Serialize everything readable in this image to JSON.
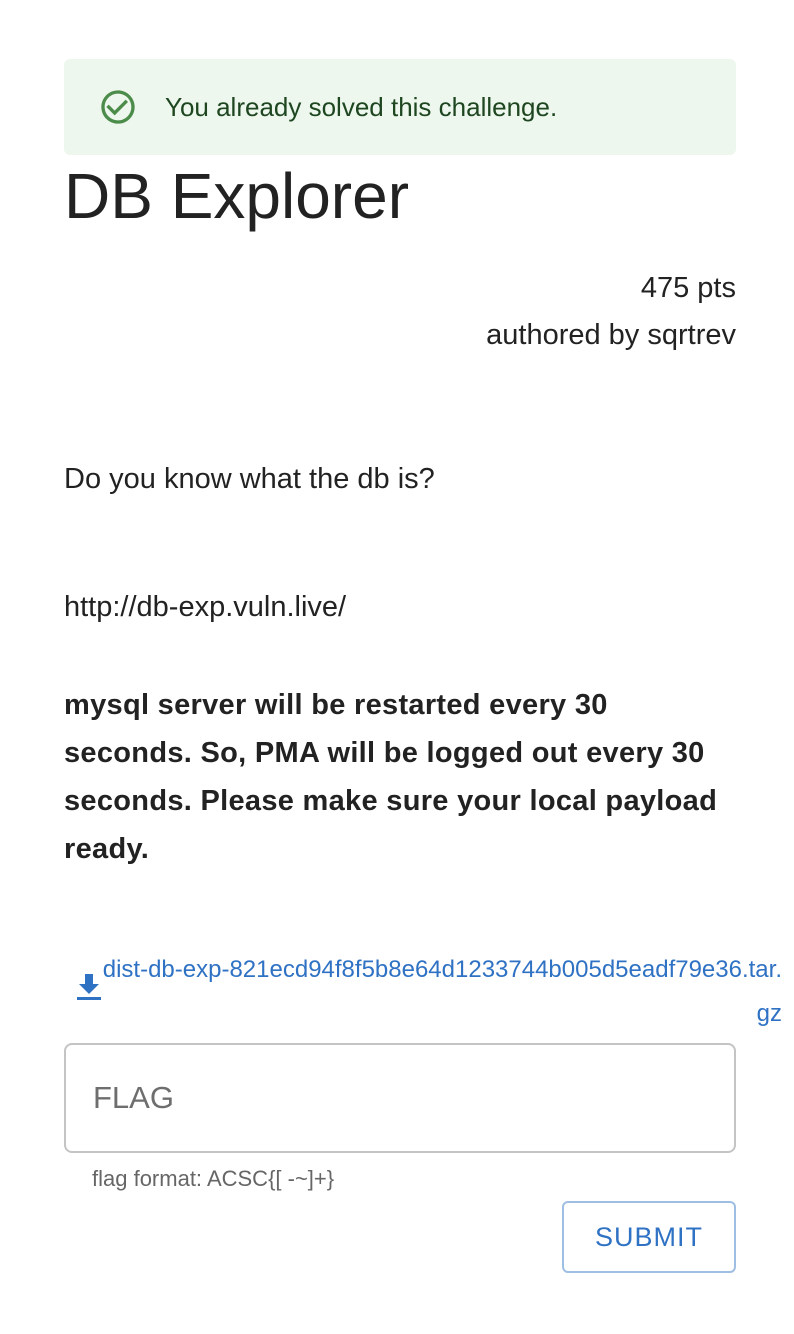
{
  "alert": {
    "message": "You already solved this challenge.",
    "icon": "check-circle-icon",
    "color": "#1e4620",
    "background": "#edf7ed"
  },
  "challenge": {
    "title": "DB Explorer",
    "points": "475 pts",
    "author": "authored by sqrtrev"
  },
  "description": {
    "question": "Do you know what the db is?",
    "url": "http://db-exp.vuln.live/",
    "notice": "mysql server will be restarted every 30 seconds. So, PMA will be logged out every 30 seconds. Please make sure your local payload ready."
  },
  "download": {
    "icon": "download-icon",
    "filename": "dist-db-exp-821ecd94f8f5b8e64d1233744b005d5eadf79e36.tar.gz",
    "color": "#2f72c4"
  },
  "flag_form": {
    "placeholder": "FLAG",
    "value": "",
    "helper": "flag format: ACSC{[ -~]+}",
    "submit_label": "SUBMIT"
  }
}
